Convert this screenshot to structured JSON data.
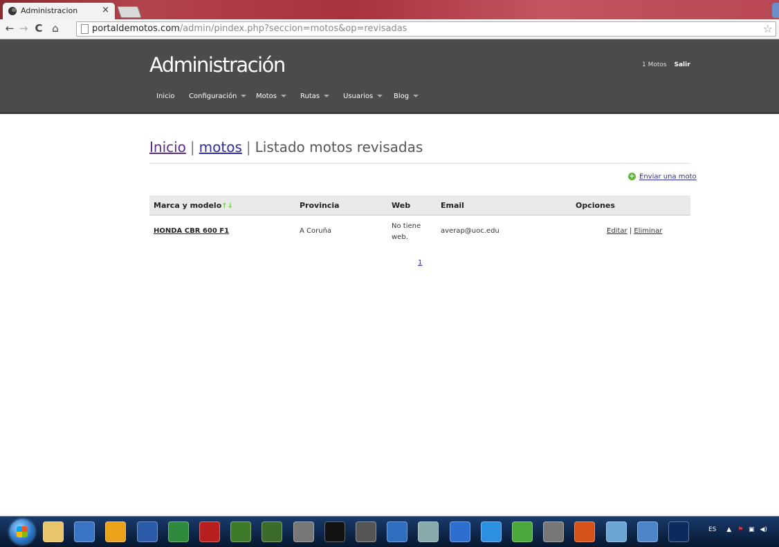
{
  "browser": {
    "tab_title": "Administracion",
    "tab_close": "×",
    "url_host": "portaldemotos.com",
    "url_path": "/admin/pindex.php?seccion=motos&op=revisadas"
  },
  "header": {
    "brand": "Administración",
    "user_count": "1 Motos",
    "logout": "Salir",
    "nav": [
      "Inicio",
      "Configuración",
      "Motos",
      "Rutas",
      "Usuarios",
      "Blog"
    ]
  },
  "breadcrumb": {
    "home": "Inicio",
    "section": "motos",
    "separator": "|",
    "current": "Listado motos revisadas"
  },
  "actions": {
    "send_moto": "Enviar una moto"
  },
  "table": {
    "columns": [
      "Marca y modelo",
      "Provincia",
      "Web",
      "Email",
      "Opciones"
    ],
    "rows": [
      {
        "model": "HONDA CBR 600 F1",
        "province": "A Coruña",
        "web_line1": "No tiene",
        "web_line2": "web.",
        "email": "averap@uoc.edu",
        "edit": "Editar",
        "delete": "Eliminar"
      }
    ]
  },
  "pagination": {
    "current": "1"
  },
  "taskbar": {
    "language": "ES",
    "icons": [
      "explorer-icon",
      "media-player-icon",
      "chrome-icon",
      "word-icon",
      "excel-icon",
      "filezilla-icon",
      "dreamweaver-icon",
      "notepad-icon",
      "inkscape-icon",
      "terminal-icon",
      "sublime-icon",
      "virtualbox-icon",
      "paint-icon",
      "network-icon",
      "ie-icon",
      "utorrent-icon",
      "app-icon",
      "firefox-icon",
      "paint-brush-icon",
      "window-icon",
      "photoshop-icon"
    ],
    "colors": {
      "taskbar": "#0d2547",
      "header": "#4b4b4b",
      "link": "#2b2ba8",
      "sort_arrow": "#6fcf45"
    }
  }
}
